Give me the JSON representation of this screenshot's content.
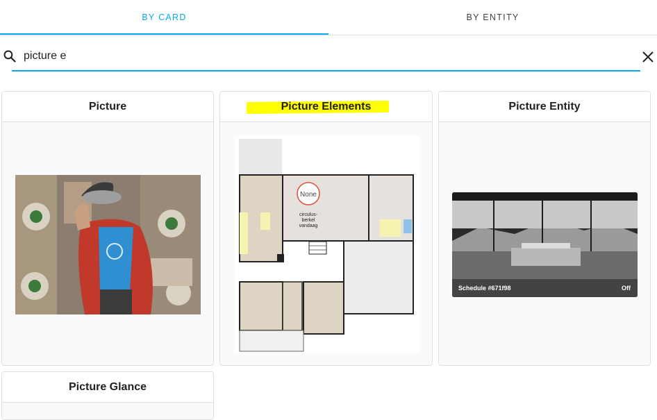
{
  "tabs": [
    {
      "label": "BY CARD",
      "active": true
    },
    {
      "label": "BY ENTITY",
      "active": false
    }
  ],
  "search": {
    "value": "picture e",
    "placeholder": ""
  },
  "cards": [
    {
      "title": "Picture"
    },
    {
      "title": "Picture Elements"
    },
    {
      "title": "Picture Entity"
    },
    {
      "title": "Picture Glance"
    }
  ],
  "floorplan": {
    "state_badge": "None",
    "label_line1": "circulus-",
    "label_line2": "berkel",
    "label_line3": "vandaag"
  },
  "entity_preview": {
    "name": "Schedule #671f98",
    "state": "Off"
  },
  "colors": {
    "accent": "#03a9f4",
    "highlight": "#ffff00"
  }
}
